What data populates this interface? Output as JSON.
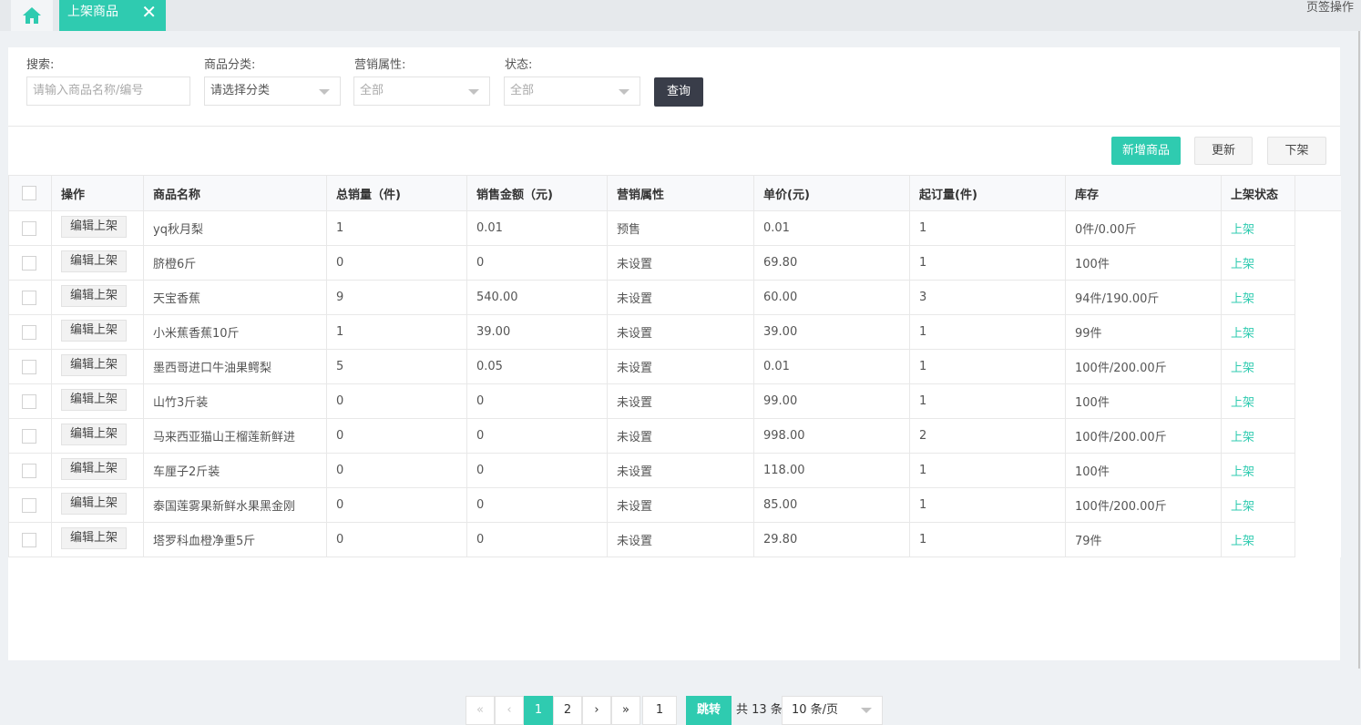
{
  "tabs": {
    "home_icon": "home-icon",
    "active_label": "上架商品",
    "close_glyph": "✕",
    "ops_label": "页签操作"
  },
  "filters": {
    "search_label": "搜索:",
    "search_placeholder": "请输入商品名称/编号",
    "category_label": "商品分类:",
    "category_value": "请选择分类",
    "marketing_label": "营销属性:",
    "marketing_value": "全部",
    "status_label": "状态:",
    "status_value": "全部",
    "query_label": "查询"
  },
  "actions": {
    "add_label": "新增商品",
    "update_label": "更新",
    "offshelf_label": "下架"
  },
  "table": {
    "headers": [
      "操作",
      "商品名称",
      "总销量（件)",
      "销售金额（元)",
      "营销属性",
      "单价(元)",
      "起订量(件)",
      "库存",
      "上架状态"
    ],
    "edit_label": "编辑上架",
    "rows": [
      {
        "name": "yq秋月梨",
        "sales": "1",
        "amount": "0.01",
        "marketing": "预售",
        "price": "0.01",
        "moq": "1",
        "stock": "0件/0.00斤",
        "status": "上架"
      },
      {
        "name": "脐橙6斤",
        "sales": "0",
        "amount": "0",
        "marketing": "未设置",
        "price": "69.80",
        "moq": "1",
        "stock": "100件",
        "status": "上架"
      },
      {
        "name": "天宝香蕉",
        "sales": "9",
        "amount": "540.00",
        "marketing": "未设置",
        "price": "60.00",
        "moq": "3",
        "stock": "94件/190.00斤",
        "status": "上架"
      },
      {
        "name": "小米蕉香蕉10斤",
        "sales": "1",
        "amount": "39.00",
        "marketing": "未设置",
        "price": "39.00",
        "moq": "1",
        "stock": "99件",
        "status": "上架"
      },
      {
        "name": "墨西哥进口牛油果鳄梨",
        "sales": "5",
        "amount": "0.05",
        "marketing": "未设置",
        "price": "0.01",
        "moq": "1",
        "stock": "100件/200.00斤",
        "status": "上架"
      },
      {
        "name": "山竹3斤装",
        "sales": "0",
        "amount": "0",
        "marketing": "未设置",
        "price": "99.00",
        "moq": "1",
        "stock": "100件",
        "status": "上架"
      },
      {
        "name": "马来西亚猫山王榴莲新鲜进",
        "sales": "0",
        "amount": "0",
        "marketing": "未设置",
        "price": "998.00",
        "moq": "2",
        "stock": "100件/200.00斤",
        "status": "上架"
      },
      {
        "name": "车厘子2斤装",
        "sales": "0",
        "amount": "0",
        "marketing": "未设置",
        "price": "118.00",
        "moq": "1",
        "stock": "100件",
        "status": "上架"
      },
      {
        "name": "泰国莲雾果新鲜水果黑金刚",
        "sales": "0",
        "amount": "0",
        "marketing": "未设置",
        "price": "85.00",
        "moq": "1",
        "stock": "100件/200.00斤",
        "status": "上架"
      },
      {
        "name": "塔罗科血橙净重5斤",
        "sales": "0",
        "amount": "0",
        "marketing": "未设置",
        "price": "29.80",
        "moq": "1",
        "stock": "79件",
        "status": "上架"
      }
    ]
  },
  "pagination": {
    "first_glyph": "«",
    "prev_glyph": "‹",
    "pages": [
      "1",
      "2"
    ],
    "current_page": "1",
    "next_glyph": "›",
    "last_glyph": "»",
    "jump_value": "1",
    "jump_label": "跳转",
    "total_text": "共 13 条",
    "per_page": "10 条/页"
  },
  "colors": {
    "accent": "#2fcbb0",
    "dark_button": "#393d49"
  }
}
